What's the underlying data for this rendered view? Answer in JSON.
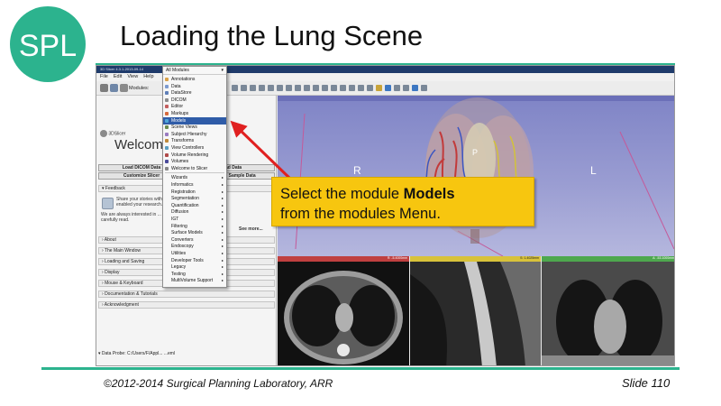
{
  "slide": {
    "title": "Loading the Lung Scene",
    "logo_text": "SPL",
    "footer_copyright": "©2012-2014 Surgical Planning Laboratory, ARR",
    "footer_slide": "Slide 110",
    "accent_color": "#2cb38e"
  },
  "app": {
    "window_title": "3D Slicer 4.3.1-2013-09-14",
    "menu": [
      "File",
      "Edit",
      "View",
      "Help"
    ],
    "modules_label": "Modules:",
    "module_selector": "All Modules"
  },
  "panel": {
    "logo_label": "3DSlicer",
    "welcome_title": "Welcome",
    "load_dicom_button": "Load DICOM Data",
    "customize_button": "Customize Slicer",
    "load_data_button": "Load Data",
    "download_sample_button": "Download Sample Data",
    "feedback_section": "Feedback",
    "feedback_line1": "Share your stories with us ... about how 3D Slicer has",
    "feedback_line2": "enabled your research.",
    "feedback_line3": "We are always interested in ... every submission will be",
    "feedback_line4": "carefully read.",
    "see_more": "See more...",
    "sections": [
      "About",
      "The Main Window",
      "Loading and Saving",
      "Display",
      "Mouse & Keyboard",
      "Documentation & Tutorials",
      "Acknowledgment"
    ],
    "data_probe": "Data Probe: C:/Users/F/Appl... ...eml",
    "probe_letters": [
      "L",
      "F",
      "B"
    ]
  },
  "dropdown": {
    "header": "All Modules",
    "items": [
      {
        "label": "Annotations",
        "icon_color": "#d9a24a",
        "submenu": false
      },
      {
        "label": "Data",
        "icon_color": "#7d9bd0",
        "submenu": false
      },
      {
        "label": "DataStore",
        "icon_color": "#5f7fb8",
        "submenu": false
      },
      {
        "label": "DICOM",
        "icon_color": "#8c8c8c",
        "submenu": false
      },
      {
        "label": "Editor",
        "icon_color": "#c45f5f",
        "submenu": false
      },
      {
        "label": "Markups",
        "icon_color": "#d66a3c",
        "submenu": false
      },
      {
        "label": "Models",
        "icon_color": "#4fa6d8",
        "submenu": false,
        "highlighted": true
      },
      {
        "label": "Scene Views",
        "icon_color": "#6a8c4f",
        "submenu": false
      },
      {
        "label": "Subject Hierarchy",
        "icon_color": "#9a7bc0",
        "submenu": false
      },
      {
        "label": "Transforms",
        "icon_color": "#c08a3a",
        "submenu": false
      },
      {
        "label": "View Controllers",
        "icon_color": "#5a9ec2",
        "submenu": false
      },
      {
        "label": "Volume Rendering",
        "icon_color": "#b04a4a",
        "submenu": false
      },
      {
        "label": "Volumes",
        "icon_color": "#4a4a9a",
        "submenu": false
      },
      {
        "label": "Welcome to Slicer",
        "icon_color": "#888888",
        "submenu": false
      },
      {
        "label": "Wizards",
        "submenu": true
      },
      {
        "label": "Informatics",
        "submenu": true
      },
      {
        "label": "Registration",
        "submenu": true
      },
      {
        "label": "Segmentation",
        "submenu": true
      },
      {
        "label": "Quantification",
        "submenu": true
      },
      {
        "label": "Diffusion",
        "submenu": true
      },
      {
        "label": "IGT",
        "submenu": true
      },
      {
        "label": "Filtering",
        "submenu": true
      },
      {
        "label": "Surface Models",
        "submenu": true
      },
      {
        "label": "Converters",
        "submenu": true
      },
      {
        "label": "Endoscopy",
        "submenu": true
      },
      {
        "label": "Utilities",
        "submenu": true
      },
      {
        "label": "Developer Tools",
        "submenu": true
      },
      {
        "label": "Legacy",
        "submenu": true
      },
      {
        "label": "Testing",
        "submenu": true
      },
      {
        "label": "MultiVolume Support",
        "submenu": true
      }
    ]
  },
  "views": {
    "orient_right": "R",
    "orient_left": "L",
    "orient_posterior": "P",
    "red_label": "R: -5.4000mm",
    "yellow_label": "S: 1.4025mm",
    "green_label": "A: -53.1000mm"
  },
  "callout": {
    "line1_pre": "Select the module ",
    "line1_bold": "Models",
    "line2": "from the modules Menu."
  }
}
